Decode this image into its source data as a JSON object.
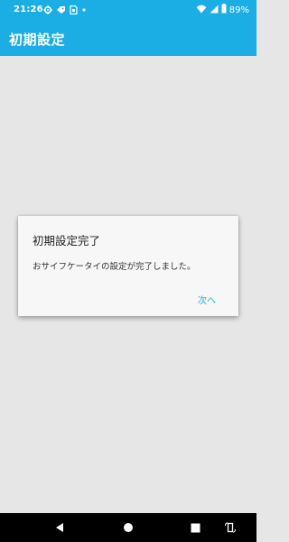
{
  "status_bar": {
    "time": "21:26",
    "battery": "89%",
    "icons": [
      "gear-icon",
      "notification-icon",
      "sim-card-icon",
      "dot-icon",
      "wifi-icon",
      "signal-icon",
      "battery-icon"
    ]
  },
  "app_bar": {
    "title": "初期設定"
  },
  "dialog": {
    "title": "初期設定完了",
    "message": "おサイフケータイの設定が完了しました。",
    "next_button": "次へ"
  },
  "nav_bar": {
    "icons": [
      "back-icon",
      "home-icon",
      "recents-icon",
      "rotate-icon"
    ]
  },
  "colors": {
    "accent": "#1aaee5",
    "background": "#e6e6e6",
    "dialog": "#f7f7f7"
  }
}
